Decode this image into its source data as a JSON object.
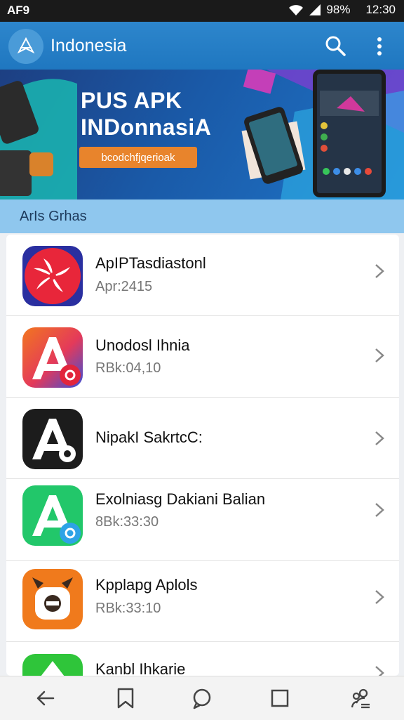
{
  "status_bar": {
    "carrier": "AF9",
    "battery": "98%",
    "time": "12:30"
  },
  "app_bar": {
    "title": "Indonesia",
    "icons": [
      "app-logo-icon",
      "search-icon",
      "more-vert-icon"
    ]
  },
  "banner": {
    "title": "PUS APK\nINDonnasiA",
    "cta": "bcodchfjqerioak"
  },
  "section": {
    "title": "ArIs Grhas"
  },
  "apps": [
    {
      "name": "ApIPTasdiastonl",
      "meta": "Apr:2415",
      "icon": "red-flower-app-icon"
    },
    {
      "name": "Unodosl Ihnia",
      "meta": "RBk:04,10",
      "icon": "gradient-a-app-icon"
    },
    {
      "name": "NipakI SakrtcC:",
      "meta": "",
      "icon": "black-a-app-icon"
    },
    {
      "name": "Exolniasg Dakiani Balian",
      "meta": "8Bk:33:30",
      "icon": "green-a-app-icon"
    },
    {
      "name": "Kpplapg Aplols",
      "meta": "RBk:33:10",
      "icon": "orange-bot-app-icon"
    },
    {
      "name": "Kanbl Ihkarie",
      "meta": "",
      "icon": "green-app-icon"
    }
  ],
  "bottom_nav": {
    "icons": [
      "back-icon",
      "bookmark-icon",
      "chat-icon",
      "recents-icon",
      "people-icon"
    ]
  },
  "colors": {
    "app_bar": "#1f77c0",
    "section": "#8fc7ee",
    "cta": "#e8842c"
  }
}
